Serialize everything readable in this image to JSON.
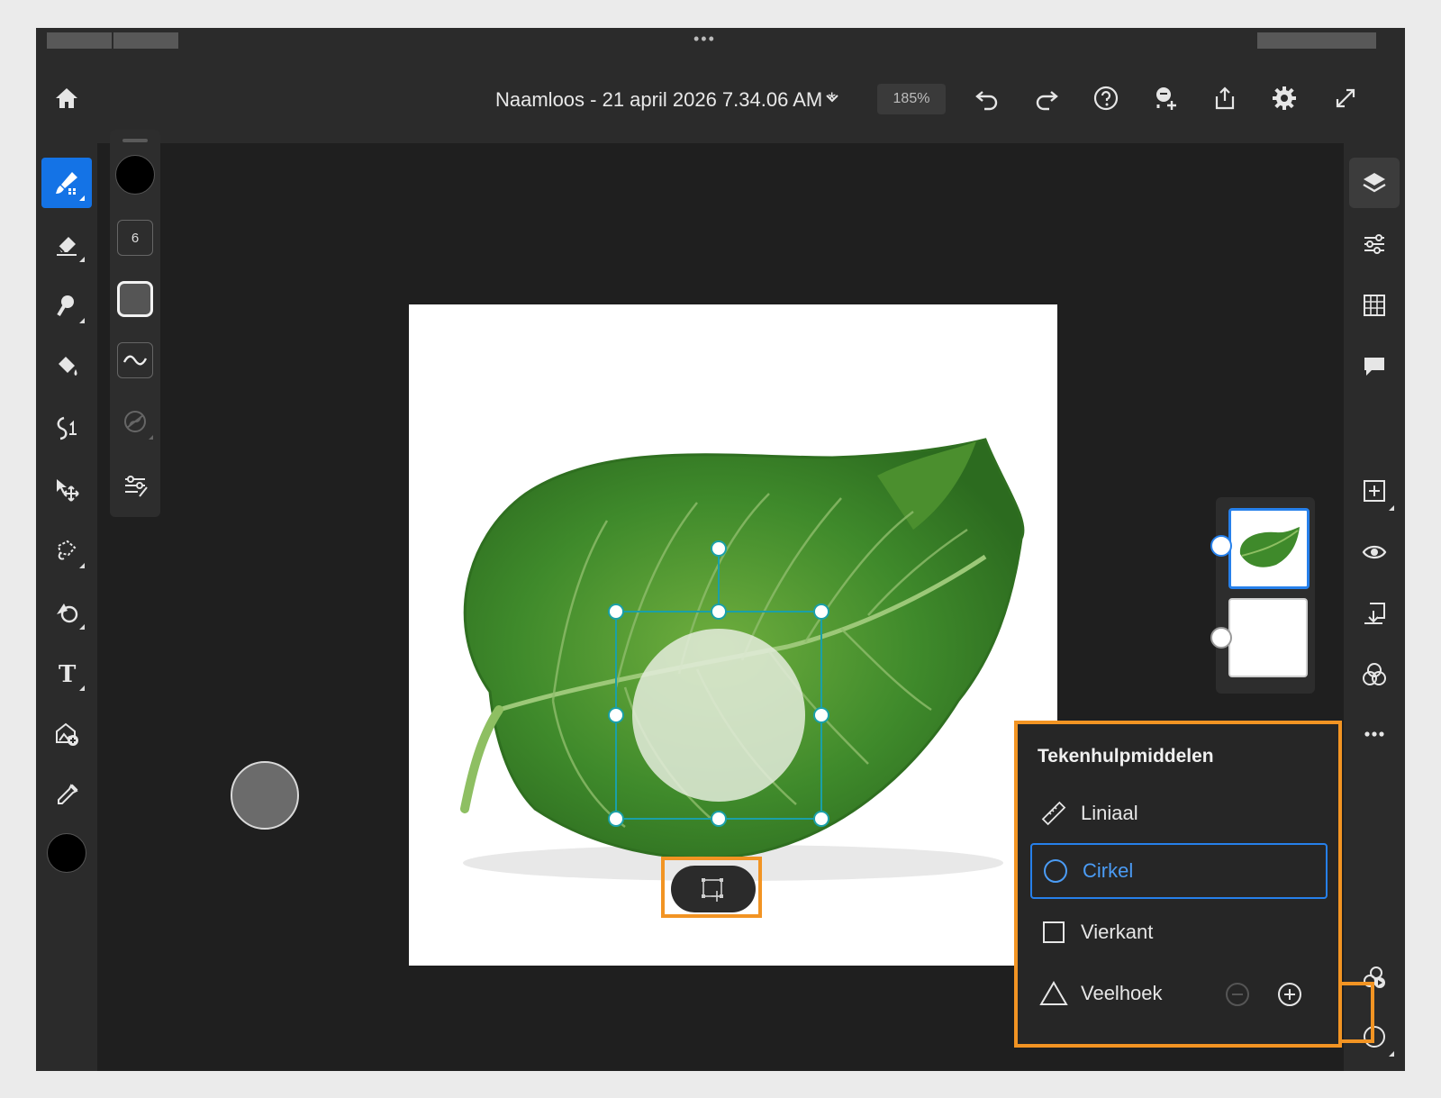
{
  "window": {
    "document_title": "Naamloos - 21 april 2026 7.34.06 AM *",
    "zoom": "185%"
  },
  "brush_panel": {
    "size_value": "6"
  },
  "colors": {
    "accent": "#1473e6",
    "highlight": "#f29423",
    "selection_blue": "#2680eb",
    "foreground_color": "#000000"
  },
  "drawing_aids": {
    "title": "Tekenhulpmiddelen",
    "items": [
      {
        "label": "Liniaal",
        "icon": "ruler-icon"
      },
      {
        "label": "Cirkel",
        "icon": "circle-icon",
        "selected": true
      },
      {
        "label": "Vierkant",
        "icon": "square-icon"
      },
      {
        "label": "Veelhoek",
        "icon": "triangle-icon"
      }
    ]
  },
  "layers": [
    {
      "name": "leaf-layer",
      "selected": true
    },
    {
      "name": "background-layer",
      "selected": false
    }
  ]
}
